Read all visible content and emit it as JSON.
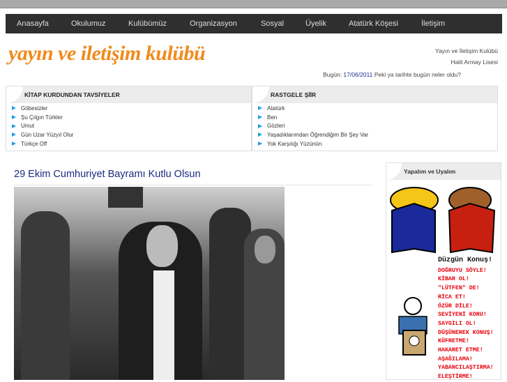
{
  "nav": [
    "Anasayfa",
    "Okulumuz",
    "Kulübümüz",
    "Organizasyon",
    "Sosyal",
    "Üyelik",
    "Atatürk Köşesi",
    "İletişim"
  ],
  "header": {
    "logo": "yayın ve iletişim kulübü",
    "line1": "Yayın ve İletişim Kulübü",
    "line2": "Halit Armay Lisesi",
    "today_label": "Bugün:",
    "today_date": "17/06/2011",
    "today_link": "Peki ya tarihte bugün neler oldu?"
  },
  "books": {
    "title": "KİTAP KURDUNDAN TAVSİYELER",
    "items": [
      "Göbesizler",
      "Şu Çılgın Türkler",
      "Umut",
      "Gün Uzar Yüzyıl Olur",
      "Türkçe Off"
    ]
  },
  "poems": {
    "title": "RASTGELE ŞİİR",
    "items": [
      "Atatürk",
      "Ben",
      "Gözleri",
      "Yaşadıklarımdan Öğrendiğim Bir Şey Var",
      "Yok Karşılığı Yüzünün"
    ]
  },
  "post": {
    "title": "29 Ekim Cumhuriyet Bayramı Kutlu Olsun"
  },
  "sidebar": {
    "title": "Yapalım ve Uyalım",
    "heading": "Düzgün Konuş!",
    "rules": [
      "DOĞRUYU SÖYLE!",
      "KİBAR OL!",
      "\"LÜTFEN\" DE!",
      "RİCA ET!",
      "ÖZÜR DİLE!",
      "SEVİYENİ KORU!",
      "SAYGILI OL!",
      "DÜŞÜNEREK KONUŞ!",
      "KÜFRETME!",
      "HAKARET ETME!",
      "AŞAĞILAMA!",
      "YABANCILAŞTIRMA!",
      "ELEŞTİRME!"
    ]
  }
}
